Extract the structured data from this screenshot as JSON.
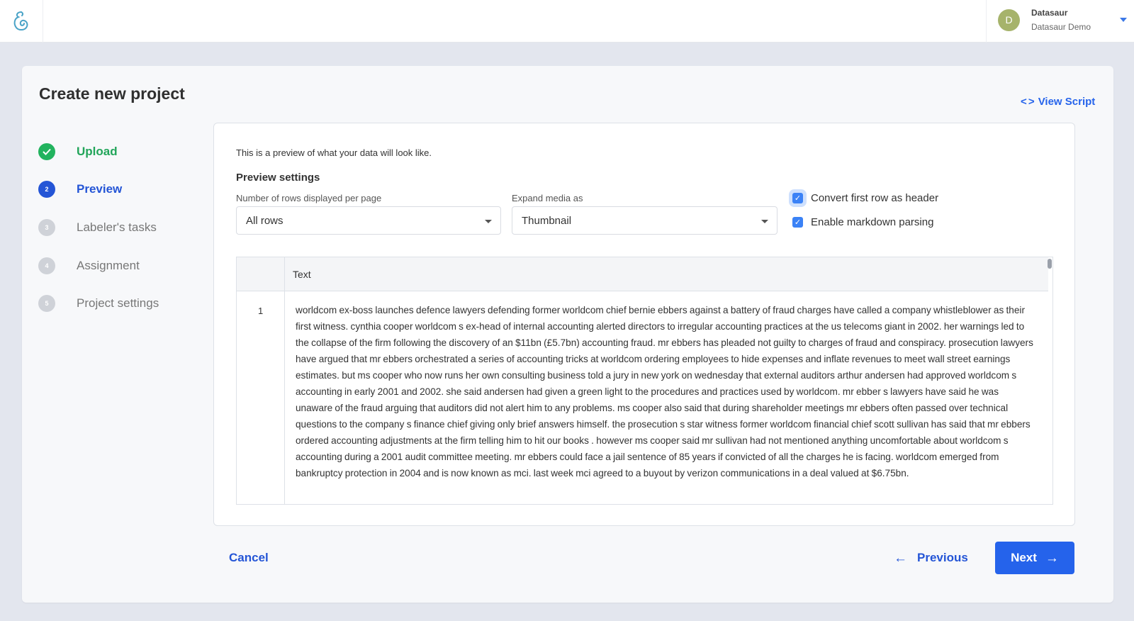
{
  "topbar": {
    "user": {
      "initial": "D",
      "name": "Datasaur",
      "team": "Datasaur Demo"
    }
  },
  "page": {
    "title": "Create new project",
    "view_script": "View Script"
  },
  "steps": [
    {
      "number": "✓",
      "label": "Upload",
      "state": "done"
    },
    {
      "number": "2",
      "label": "Preview",
      "state": "active"
    },
    {
      "number": "3",
      "label": "Labeler's tasks",
      "state": "todo"
    },
    {
      "number": "4",
      "label": "Assignment",
      "state": "todo"
    },
    {
      "number": "5",
      "label": "Project settings",
      "state": "todo"
    }
  ],
  "preview": {
    "intro": "This is a preview of what your data will look like.",
    "settings_title": "Preview settings",
    "rows_label": "Number of rows displayed per page",
    "rows_value": "All rows",
    "media_label": "Expand media as",
    "media_value": "Thumbnail",
    "convert_header_label": "Convert first row as header",
    "convert_header_checked": true,
    "markdown_label": "Enable markdown parsing",
    "markdown_checked": true
  },
  "table": {
    "column_header": "Text",
    "rows": [
      {
        "index": "1",
        "text": "worldcom ex-boss launches defence lawyers defending former worldcom chief bernie ebbers against a battery of fraud charges have called a company whistleblower as their first witness.  cynthia cooper  worldcom s ex-head of internal accounting  alerted directors to irregular accounting practices at the us telecoms giant in 2002. her warnings led to the collapse of the firm following the discovery of an $11bn (£5.7bn) accounting fraud. mr ebbers has pleaded not guilty to charges of fraud and conspiracy.  prosecution lawyers have argued that mr ebbers orchestrated a series of accounting tricks at worldcom  ordering employees to hide expenses and inflate revenues to meet wall street earnings estimates. but ms cooper  who now runs her own consulting business  told a jury in new york on wednesday that external auditors arthur andersen had approved worldcom s accounting in early 2001 and 2002. she said andersen had given a green light  to the procedures and practices used by worldcom. mr ebber s lawyers have said he was unaware of the fraud  arguing that auditors did not alert him to any problems.  ms cooper also said that during shareholder meetings mr ebbers often passed over technical questions to the company s finance chief  giving only  brief  answers himself. the prosecution s star witness  former worldcom financial chief scott sullivan  has said that mr ebbers ordered accounting adjustments at the firm  telling him to  hit our books . however  ms cooper said mr sullivan had not mentioned  anything uncomfortable  about worldcom s accounting during a 2001 audit committee meeting. mr ebbers could face a jail sentence of 85 years if convicted of all the charges he is facing. worldcom emerged from bankruptcy protection in 2004  and is now known as mci. last week  mci agreed to a buyout by verizon communications in a deal valued at $6.75bn."
      }
    ]
  },
  "actions": {
    "cancel": "Cancel",
    "previous": "Previous",
    "next": "Next"
  }
}
